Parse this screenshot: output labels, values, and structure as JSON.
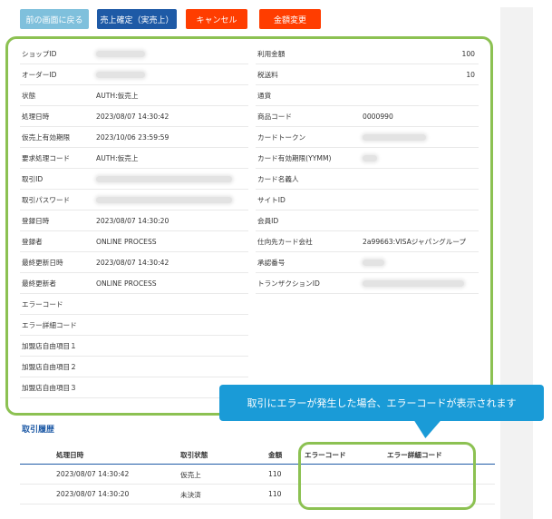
{
  "toolbar": {
    "back_label": "前の画面に戻る",
    "confirm_label": "売上確定（実売上）",
    "cancel_label": "キャンセル",
    "change_label": "金額変更"
  },
  "colors": {
    "accent_green": "#8cc152",
    "navy": "#1e5aa6",
    "red": "#ff3d00",
    "callout_blue": "#1a9bd7"
  },
  "details_left": [
    {
      "label": "ショップID",
      "value": "",
      "redacted": true
    },
    {
      "label": "オーダーID",
      "value": "",
      "redacted": true
    },
    {
      "label": "状態",
      "value": "AUTH:仮売上"
    },
    {
      "label": "処理日時",
      "value": "2023/08/07 14:30:42"
    },
    {
      "label": "仮売上有効期限",
      "value": "2023/10/06 23:59:59"
    },
    {
      "label": "要求処理コード",
      "value": "AUTH:仮売上"
    },
    {
      "label": "取引ID",
      "value": "",
      "redacted": true
    },
    {
      "label": "取引パスワード",
      "value": "",
      "redacted": true
    },
    {
      "label": "登録日時",
      "value": "2023/08/07 14:30:20"
    },
    {
      "label": "登録者",
      "value": "ONLINE PROCESS"
    },
    {
      "label": "最終更新日時",
      "value": "2023/08/07 14:30:42"
    },
    {
      "label": "最終更新者",
      "value": "ONLINE PROCESS"
    },
    {
      "label": "エラーコード",
      "value": ""
    },
    {
      "label": "エラー詳細コード",
      "value": ""
    },
    {
      "label": "加盟店自由項目１",
      "value": ""
    },
    {
      "label": "加盟店自由項目２",
      "value": ""
    },
    {
      "label": "加盟店自由項目３",
      "value": ""
    }
  ],
  "details_right": [
    {
      "label": "利用金額",
      "value": "100",
      "numeric": true
    },
    {
      "label": "税送料",
      "value": "10",
      "numeric": true
    },
    {
      "label": "通貨",
      "value": ""
    },
    {
      "label": "商品コード",
      "value": "0000990"
    },
    {
      "label": "カードトークン",
      "value": "",
      "redacted": true
    },
    {
      "label": "カード有効期限(YYMM)",
      "value": "",
      "redacted": true
    },
    {
      "label": "カード名義人",
      "value": ""
    },
    {
      "label": "サイトID",
      "value": ""
    },
    {
      "label": "会員ID",
      "value": ""
    },
    {
      "label": "仕向先カード会社",
      "value": "2a99663:VISAジャパングループ"
    },
    {
      "label": "承認番号",
      "value": "",
      "redacted": true
    },
    {
      "label": "トランザクションID",
      "value": "",
      "redacted": true
    }
  ],
  "callout": {
    "text": "取引にエラーが発生した場合、エラーコードが表示されます"
  },
  "history": {
    "title": "取引履歴",
    "columns": [
      "処理日時",
      "取引状態",
      "金額",
      "エラーコード",
      "エラー詳細コード"
    ],
    "rows": [
      {
        "datetime": "2023/08/07 14:30:42",
        "status": "仮売上",
        "amount": "110",
        "error_code": "",
        "error_detail": ""
      },
      {
        "datetime": "2023/08/07 14:30:20",
        "status": "未決済",
        "amount": "110",
        "error_code": "",
        "error_detail": ""
      }
    ]
  }
}
